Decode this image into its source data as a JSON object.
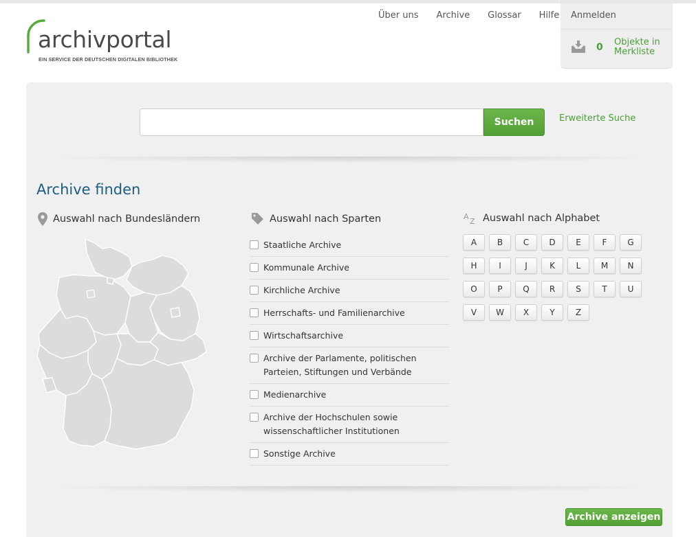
{
  "logo": {
    "word": "archivportal",
    "tagline": "EIN SERVICE DER DEUTSCHEN DIGITALEN BIBLIOTHEK"
  },
  "nav": [
    "Über uns",
    "Archive",
    "Glossar",
    "Hilfe"
  ],
  "userbox": {
    "login": "Anmelden",
    "count": "0",
    "merkliste": "Objekte in Merkliste"
  },
  "search": {
    "placeholder": "",
    "button": "Suchen",
    "advanced": "Erweiterte Suche"
  },
  "finder": {
    "title": "Archive finden",
    "states_heading": "Auswahl nach Bundesländern",
    "sparten_heading": "Auswahl nach Sparten",
    "alphabet_heading": "Auswahl nach Alphabet",
    "sparten": [
      "Staatliche Archive",
      "Kommunale Archive",
      "Kirchliche Archive",
      "Herrschafts- und Familienarchive",
      "Wirtschaftsarchive",
      "Archive der Parlamente, politischen Parteien, Stiftungen und Verbände",
      "Medienarchive",
      "Archive der Hochschulen sowie wissenschaftlicher Institutionen",
      "Sonstige Archive"
    ],
    "letters": [
      "A",
      "B",
      "C",
      "D",
      "E",
      "F",
      "G",
      "H",
      "I",
      "J",
      "K",
      "L",
      "M",
      "N",
      "O",
      "P",
      "Q",
      "R",
      "S",
      "T",
      "U",
      "V",
      "W",
      "X",
      "Y",
      "Z"
    ],
    "show_button": "Archive anzeigen"
  },
  "colors": {
    "accent_green": "#53a035",
    "title_blue": "#1c5d82"
  }
}
